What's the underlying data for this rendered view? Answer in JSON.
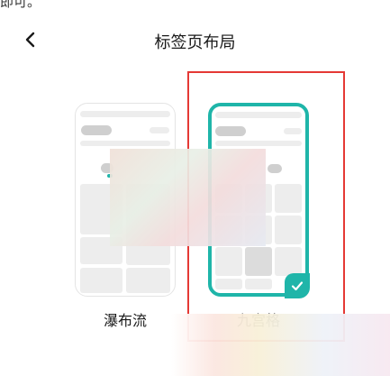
{
  "top_text": "即可。",
  "header": {
    "title": "标签页布局"
  },
  "options": [
    {
      "label": "瀑布流",
      "selected": false
    },
    {
      "label": "九宫格",
      "selected": true
    }
  ],
  "colors": {
    "accent": "#1fb5a9",
    "highlight": "#e53935"
  },
  "icons": {
    "back": "chevron-left-icon",
    "check": "check-icon"
  }
}
